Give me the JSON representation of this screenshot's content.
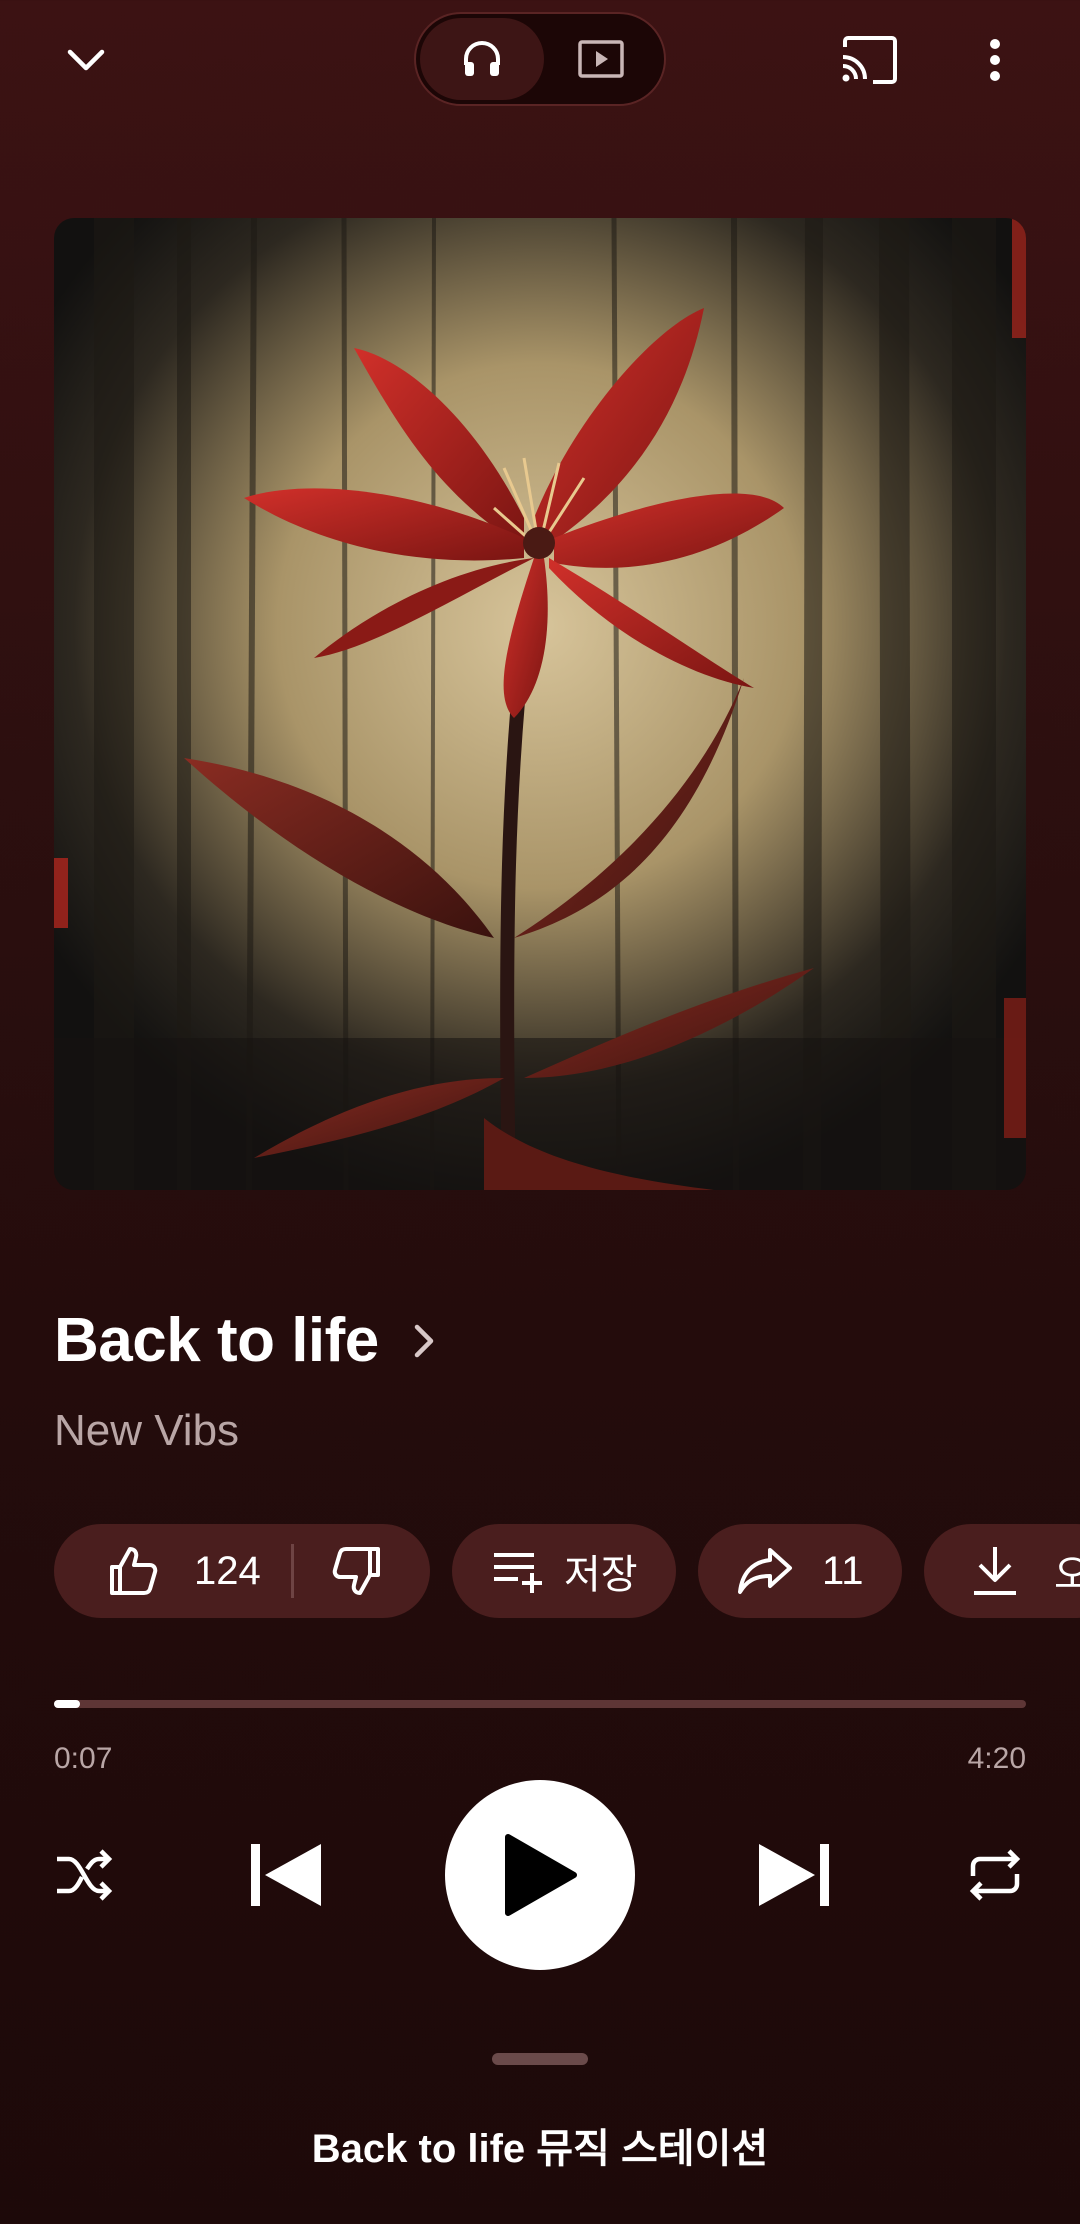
{
  "colors": {
    "background_top": "#3c1213",
    "background_bottom": "#1d0909",
    "pill_background": "#4a1e1e",
    "secondary_text": "#b9a6a6",
    "progress_track": "#5e3636",
    "accent": "#ffffff"
  },
  "top_bar": {
    "collapse_icon": "chevron-down-icon",
    "modes": [
      {
        "name": "song",
        "icon": "headphones-icon",
        "selected": true
      },
      {
        "name": "video",
        "icon": "video-play-icon",
        "selected": false
      }
    ],
    "cast_icon": "cast-icon",
    "more_icon": "more-vertical-icon"
  },
  "artwork": {
    "description_icon": "album-art"
  },
  "song": {
    "title": "Back to life",
    "artist": "New Vibs"
  },
  "actions": {
    "like_count": "124",
    "save_label": "저장",
    "share_count": "11",
    "download_label": "오"
  },
  "playback": {
    "elapsed": "0:07",
    "duration": "4:20",
    "progress_fraction": 0.027
  },
  "up_next": {
    "label": "Back to life 뮤직 스테이션"
  }
}
